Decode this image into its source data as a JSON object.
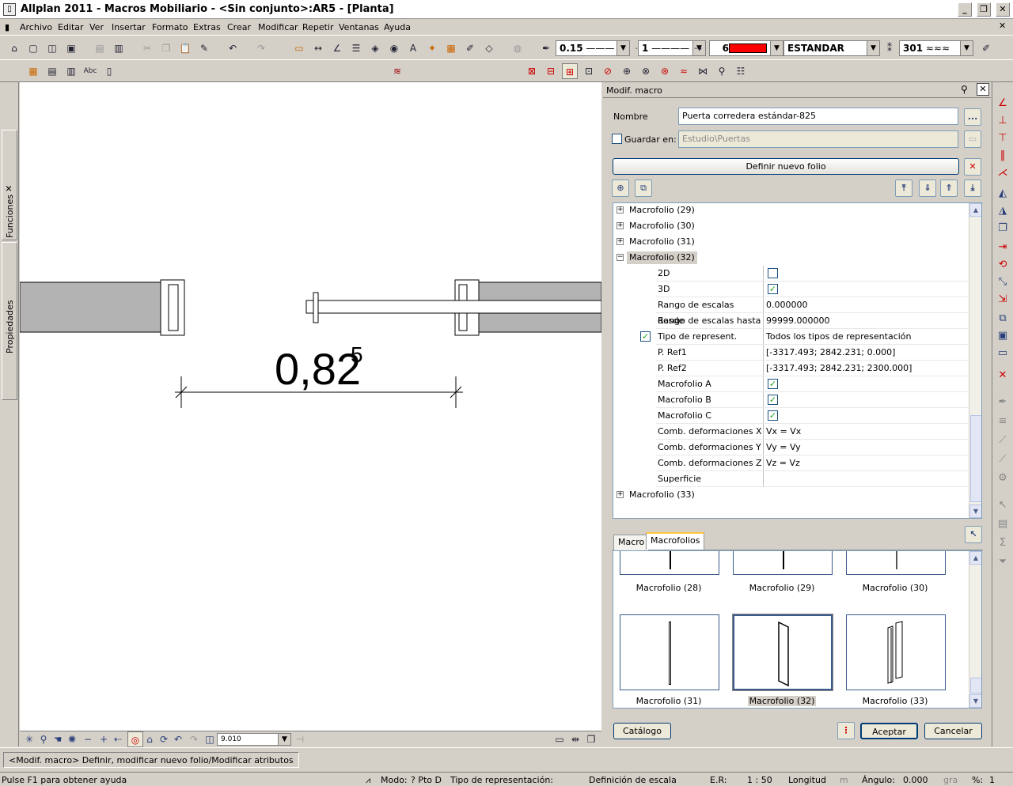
{
  "window": {
    "title": "Allplan 2011 - Macros Mobiliario - <Sin conjunto>:AR5 - [Planta]",
    "controls": [
      "_",
      "❐",
      "✕"
    ]
  },
  "menu": [
    "Archivo",
    "Editar",
    "Ver",
    "Insertar",
    "Formato",
    "Extras",
    "Crear",
    "Modificar",
    "Repetir",
    "Ventanas",
    "Ayuda"
  ],
  "format_toolbar": {
    "pen": "0.15",
    "line": "1",
    "color": "6",
    "color_hex": "#ff0000",
    "layer": "ESTANDAR",
    "pattern": "301"
  },
  "left_dock": {
    "tab_functions": "Funciones",
    "tab_properties": "Propiedades"
  },
  "canvas": {
    "dimension_main": "0,82",
    "dimension_sup": "5"
  },
  "view_toolbar": {
    "scale_value": "9.010"
  },
  "panel": {
    "title": "Modif. macro",
    "name_label": "Nombre",
    "name_value": "Puerta corredera estándar-825",
    "browse_label": "...",
    "save_in_label": "Guardar en:",
    "save_in_value": "Estudio\\Puertas",
    "define_button": "Definir nuevo folio",
    "tree": {
      "collapsed_top": [
        "Macrofolio (29)",
        "Macrofolio (30)",
        "Macrofolio (31)"
      ],
      "expanded": "Macrofolio (32)",
      "properties": [
        {
          "label": "2D",
          "value": "",
          "checkbox": true,
          "checked": false
        },
        {
          "label": "3D",
          "value": "",
          "checkbox": true,
          "checked": true
        },
        {
          "label": "Rango de escalas desde",
          "value": "0.000000"
        },
        {
          "label": "Rango de escalas hasta",
          "value": "99999.000000"
        },
        {
          "label": "Tipo de represent.",
          "value": "Todos los tipos de representación",
          "leading_check": true
        },
        {
          "label": "P. Ref1",
          "value": "[-3317.493; 2842.231; 0.000]"
        },
        {
          "label": "P. Ref2",
          "value": "[-3317.493; 2842.231; 2300.000]"
        },
        {
          "label": "Macrofolio A",
          "value": "",
          "checkbox": true,
          "checked": true
        },
        {
          "label": "Macrofolio B",
          "value": "",
          "checkbox": true,
          "checked": true
        },
        {
          "label": "Macrofolio C",
          "value": "",
          "checkbox": true,
          "checked": true
        },
        {
          "label": "Comb. deformaciones X",
          "value": "Vx = Vx"
        },
        {
          "label": "Comb. deformaciones Y",
          "value": "Vy = Vy"
        },
        {
          "label": "Comb. deformaciones Z",
          "value": "Vz = Vz"
        },
        {
          "label": "Superficie",
          "value": ""
        }
      ],
      "collapsed_bottom": [
        "Macrofolio (33)"
      ]
    },
    "tabs": [
      "Macro",
      "Macrofolios"
    ],
    "active_tab": "Macrofolios",
    "thumbnails_top": [
      "Macrofolio (28)",
      "Macrofolio (29)",
      "Macrofolio (30)"
    ],
    "thumbnails": [
      "Macrofolio (31)",
      "Macrofolio (32)",
      "Macrofolio (33)"
    ],
    "selected_thumbnail": "Macrofolio (32)",
    "catalog_button": "Catálogo",
    "accept_button": "Aceptar",
    "cancel_button": "Cancelar"
  },
  "command_line": "<Modif. macro> Definir, modificar nuevo folio/Modificar atributos",
  "status": {
    "help": "Pulse F1 para obtener ayuda",
    "mode": "Modo:",
    "mode_value": "? Pto D",
    "repr": "Tipo de representación:",
    "scale_def": "Definición de escala",
    "er_label": "E.R:",
    "er_value": "1 : 50",
    "length_label": "Longitud",
    "length_unit": "m",
    "angle_label": "Ángulo:",
    "angle_value": "0.000",
    "angle_unit": "gra",
    "percent_label": "%:",
    "percent_value": "1"
  }
}
